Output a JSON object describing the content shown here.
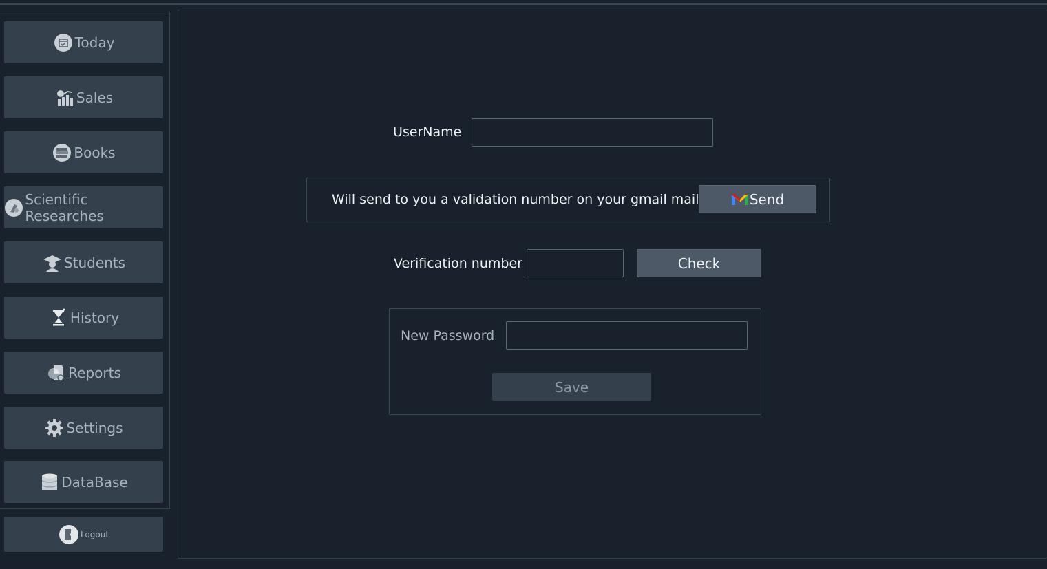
{
  "sidebar": {
    "items": [
      {
        "label": "Today",
        "icon": "calendar-icon"
      },
      {
        "label": "Sales",
        "icon": "sales-chart-icon"
      },
      {
        "label": "Books",
        "icon": "books-icon"
      },
      {
        "label": "Scientific Researches",
        "icon": "research-icon"
      },
      {
        "label": "Students",
        "icon": "graduate-icon"
      },
      {
        "label": "History",
        "icon": "hourglass-icon"
      },
      {
        "label": "Reports",
        "icon": "report-icon"
      },
      {
        "label": "Settings",
        "icon": "gear-icon"
      },
      {
        "label": "DataBase",
        "icon": "database-icon"
      }
    ],
    "logout_label": "Logout"
  },
  "form": {
    "username_label": "UserName",
    "username_value": "",
    "gmail_note": "Will send to you a validation number on your gmail mail",
    "send_label": "Send",
    "verification_label": "Verification number",
    "verification_value": "",
    "check_label": "Check",
    "new_password_label": "New Password",
    "new_password_value": "",
    "save_label": "Save"
  },
  "colors": {
    "background": "#19222c",
    "button": "#34414d",
    "active_button": "#4d5966",
    "text": "#eef2f5",
    "muted_text": "#a9b3bc"
  }
}
